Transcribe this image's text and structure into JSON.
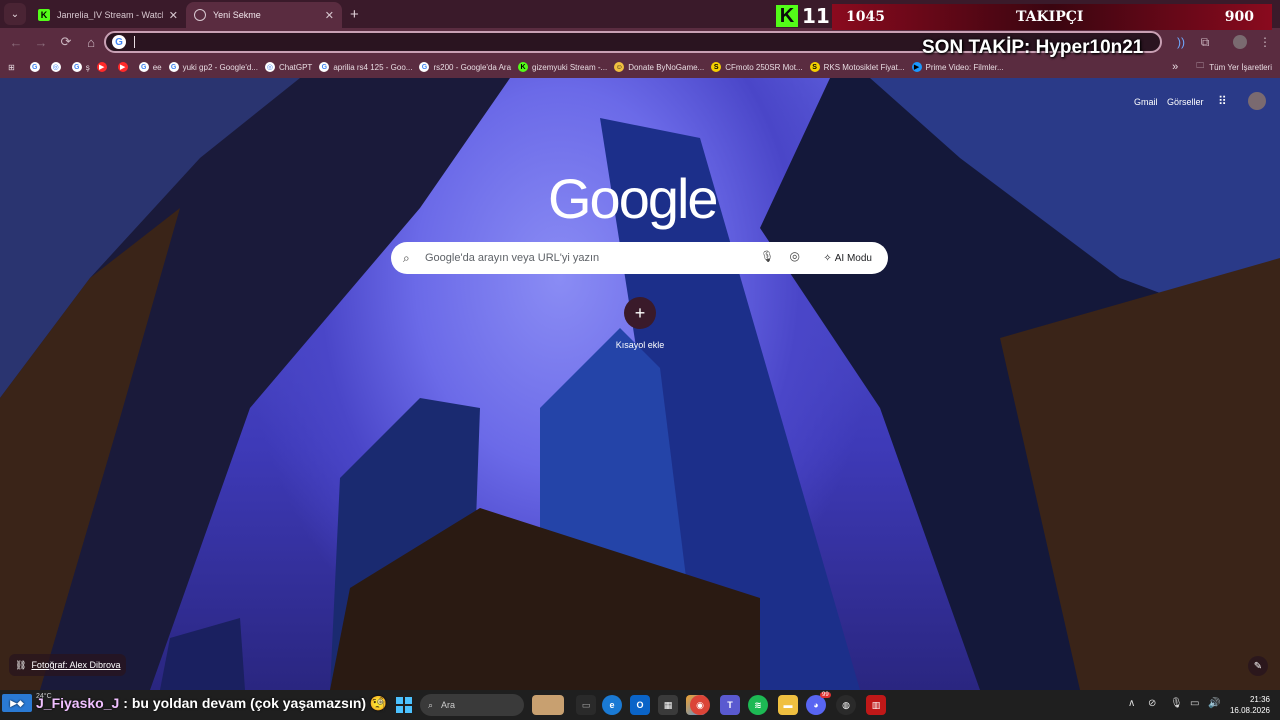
{
  "tabs": [
    {
      "title": "Janrelia_IV Stream - Watch Live...",
      "active": false,
      "favicon": "kick-icon"
    },
    {
      "title": "Yeni Sekme",
      "active": true,
      "favicon": "newtab-icon"
    }
  ],
  "new_tab_symbol": "+",
  "close_symbol": "✕",
  "toolbar": {
    "back": "←",
    "forward": "→",
    "reload": "⟳",
    "home": "⌂",
    "omnibox_value": "",
    "omnibox_g": "G",
    "mic": "🎙",
    "extensions": "⧉"
  },
  "bookmarks": [
    {
      "label": "",
      "icon": "google-icon",
      "color": "#ffffff"
    },
    {
      "label": "",
      "icon": "chatgpt-icon",
      "color": "#ffffff"
    },
    {
      "label": "ş",
      "icon": "google-icon",
      "color": "#ffffff"
    },
    {
      "label": "",
      "icon": "youtube-icon",
      "color": "#ff2a2a"
    },
    {
      "label": "",
      "icon": "youtube-icon",
      "color": "#ff2a2a"
    },
    {
      "label": "ee",
      "icon": "google-icon",
      "color": "#ffffff"
    },
    {
      "label": "yuki gp2 - Google'd...",
      "icon": "google-icon",
      "color": "#ffffff"
    },
    {
      "label": "ChatGPT",
      "icon": "chatgpt-icon",
      "color": "#ffffff"
    },
    {
      "label": "aprilia rs4 125 - Goo...",
      "icon": "google-icon",
      "color": "#ffffff"
    },
    {
      "label": "rs200 - Google'da Ara",
      "icon": "google-icon",
      "color": "#ffffff"
    },
    {
      "label": "gizemyuki Stream -...",
      "icon": "kick-icon",
      "color": "#53fc18"
    },
    {
      "label": "Donate ByNoGame...",
      "icon": "donate-icon",
      "color": "#f0c040"
    },
    {
      "label": "CFmoto 250SR Mot...",
      "icon": "s-icon",
      "color": "#f5d000"
    },
    {
      "label": "RKS Motosiklet Fiyat...",
      "icon": "s-icon",
      "color": "#f5d000"
    },
    {
      "label": "Prime Video: Filmler...",
      "icon": "prime-icon",
      "color": "#1a98ff"
    }
  ],
  "bookmarks_more": "»",
  "all_bookmarks": "Tüm Yer İşaretleri",
  "newtab": {
    "gmail": "Gmail",
    "images": "Görseller",
    "logo": "Google",
    "search_placeholder": "Google'da arayın veya URL'yi yazın",
    "ai_mode": "AI Modu",
    "add_shortcut_symbol": "+",
    "add_shortcut_label": "Kısayol ekle",
    "photo_credit": "Fotoğraf: Alex Dibrova"
  },
  "overlay": {
    "kick_number": "11",
    "follower_count": "1045",
    "follower_label": "TAKIPÇI",
    "follower_goal": "900",
    "last_follow": "SON TAKİP: Hyper10n21"
  },
  "taskbar": {
    "weather_temp": "24°C",
    "chat_user": "J_Fiyasko_J",
    "chat_message": ": bu yoldan devam (çok yaşamazsın) 🧐",
    "search_label": "Ara",
    "time": "21:36",
    "date": "16.08.2026",
    "tray_chevron": "∧",
    "notification_count": "99"
  },
  "colors": {
    "accent": "#5a2c40",
    "tab_bg": "#3a1a2a",
    "kick_green": "#53fc18",
    "overlay_red": "#8a0a1e"
  }
}
